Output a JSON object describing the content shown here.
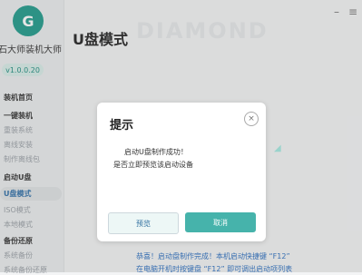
{
  "app": {
    "title": "石大师装机大师",
    "version": "v1.0.0.20"
  },
  "sidebar": {
    "items": [
      {
        "label": "装机首页"
      },
      {
        "label": "一键装机"
      },
      {
        "label": "重装系统"
      },
      {
        "label": "离线安装"
      },
      {
        "label": "制作离线包"
      },
      {
        "label": "启动U盘"
      },
      {
        "label": "U盘模式"
      },
      {
        "label": "ISO模式"
      },
      {
        "label": "本地模式"
      },
      {
        "label": "备份还原"
      },
      {
        "label": "系统备份"
      },
      {
        "label": "系统备份还原"
      }
    ]
  },
  "main": {
    "title": "U盘模式",
    "watermark": "DIAMOND"
  },
  "topbar": {
    "minimize": "–",
    "menu": "≡"
  },
  "dialog": {
    "title": "提示",
    "close": "×",
    "messages": [
      "启动U盘制作成功！",
      "是否立即预览该启动设备"
    ],
    "buttons": {
      "preview": "预览",
      "cancel": "取消"
    }
  },
  "footer": {
    "line1": "恭喜！启动盘制作完成！本机启动快捷键 “F12”",
    "line2": "在电脑开机时按键盘 “F12” 即可调出启动项列表"
  }
}
